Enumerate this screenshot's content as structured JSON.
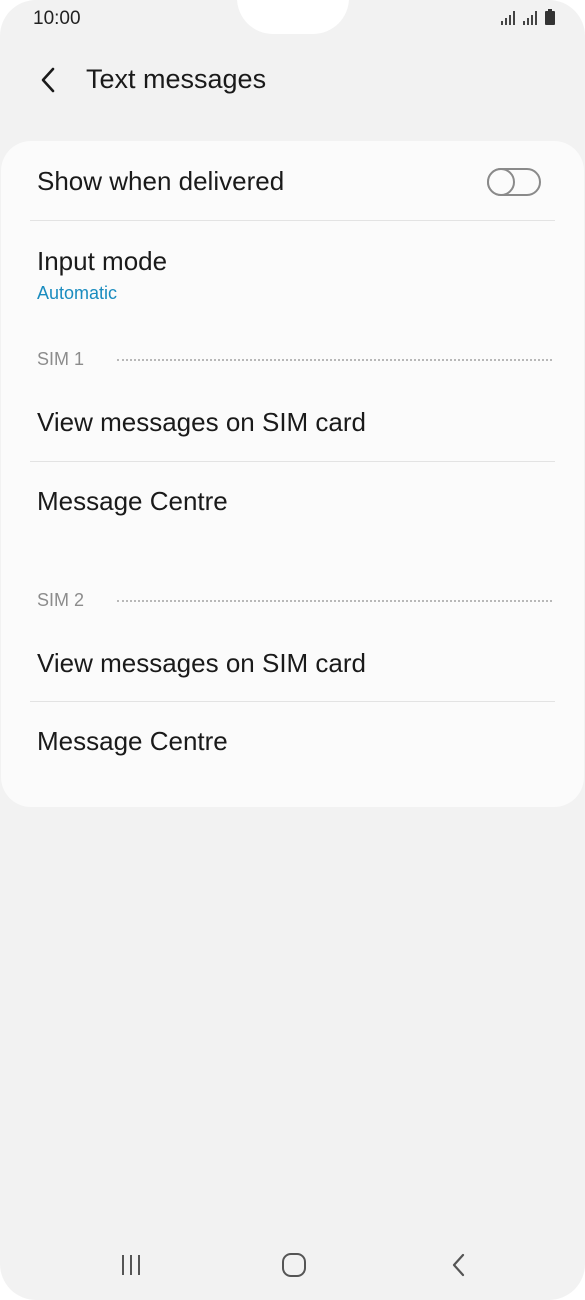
{
  "status_bar": {
    "time": "10:00",
    "icons": [
      "signal-sim1-icon",
      "signal-sim2-icon",
      "battery-icon"
    ]
  },
  "header": {
    "title": "Text messages",
    "back_icon": "chevron-left-icon"
  },
  "settings": {
    "show_when_delivered": {
      "label": "Show when delivered",
      "toggle_on": false
    },
    "input_mode": {
      "label": "Input mode",
      "value": "Automatic"
    },
    "sim1": {
      "header": "SIM 1",
      "items": [
        "View messages on SIM card",
        "Message Centre"
      ]
    },
    "sim2": {
      "header": "SIM 2",
      "items": [
        "View messages on SIM card",
        "Message Centre"
      ]
    }
  },
  "nav_bar": {
    "icons": [
      "recent-apps-icon",
      "home-icon",
      "back-icon"
    ]
  },
  "colors": {
    "background": "#f2f2f2",
    "card": "#fbfbfb",
    "accent": "#1a8cbf",
    "text": "#1a1a1a",
    "section_header": "#8c8c8c"
  }
}
